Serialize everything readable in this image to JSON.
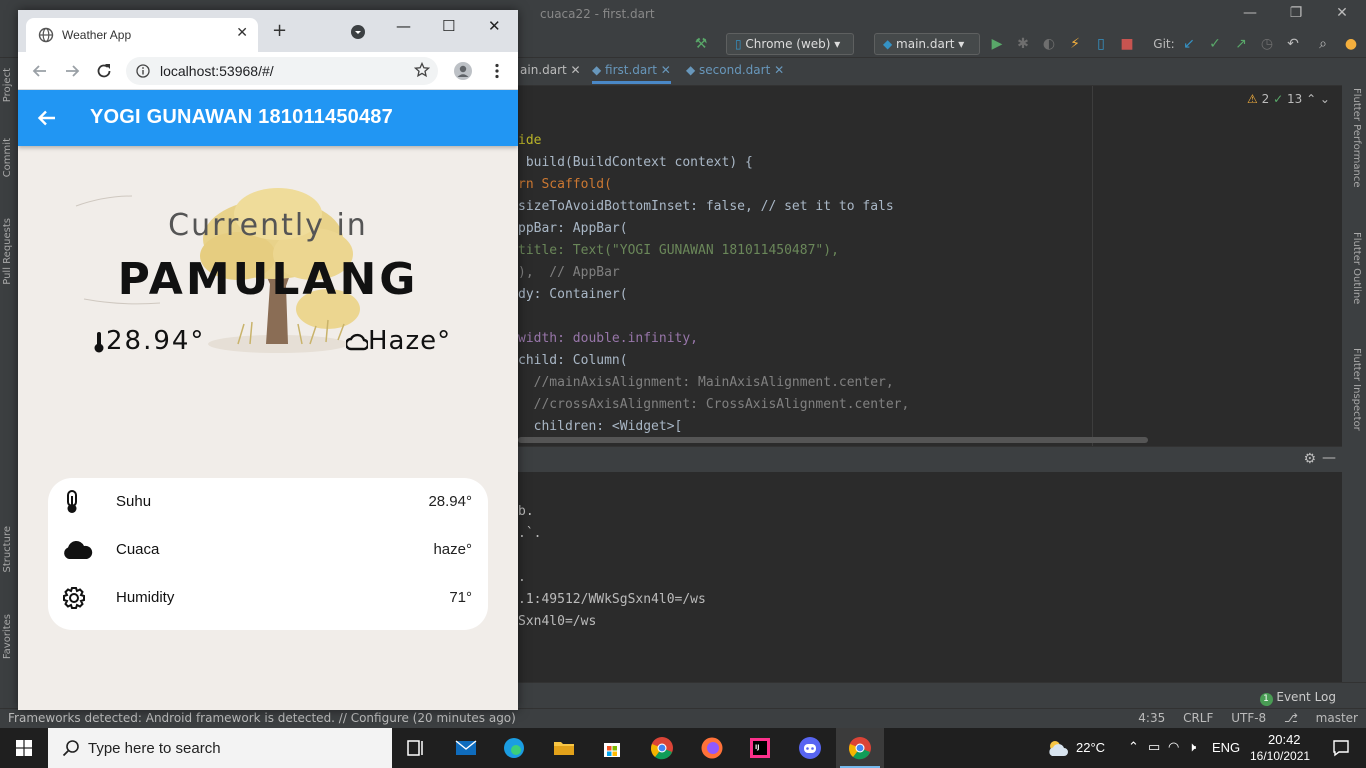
{
  "ide": {
    "window_title": "cuaca22 - first.dart",
    "device_selector": "Chrome (web)",
    "run_config": "main.dart",
    "git_label": "Git:",
    "tabs": [
      {
        "label": "ain.dart"
      },
      {
        "label": "first.dart"
      },
      {
        "label": "second.dart"
      }
    ],
    "inspections": {
      "warnings": "2",
      "typos": "13"
    },
    "left_tool_windows": [
      "Project",
      "Commit",
      "Pull Requests",
      "Structure",
      "Favorites"
    ],
    "right_tool_windows": [
      "Flutter Performance",
      "Flutter Outline",
      "Flutter Inspector"
    ],
    "code_lines": [
      {
        "text": "ide",
        "color": "#bbb529"
      },
      {
        "text": " build(BuildContext context) {",
        "color": "#a9b7c6"
      },
      {
        "text": "rn Scaffold(",
        "color": "#cc7832"
      },
      {
        "text": "sizeToAvoidBottomInset: false, // set it to fals",
        "color": "#a9b7c6"
      },
      {
        "text": "ppBar: AppBar(",
        "color": "#a9b7c6"
      },
      {
        "text": "title: Text(\"YOGI GUNAWAN 181011450487\"),",
        "color": "#6a8759"
      },
      {
        "text": "),  // AppBar",
        "color": "#808080"
      },
      {
        "text": "dy: Container(",
        "color": "#a9b7c6"
      },
      {
        "text": "",
        "color": "#a9b7c6"
      },
      {
        "text": "width: double.infinity,",
        "color": "#9876aa"
      },
      {
        "text": "child: Column(",
        "color": "#a9b7c6"
      },
      {
        "text": "  //mainAxisAlignment: MainAxisAlignment.center,",
        "color": "#808080"
      },
      {
        "text": "  //crossAxisAlignment: CrossAxisAlignment.center,",
        "color": "#808080"
      },
      {
        "text": "  children: <Widget>[",
        "color": "#a9b7c6"
      }
    ],
    "console_lines": [
      "b.",
      ".`.",
      "",
      ".",
      ".1:49512/WWkSgSxn4l0=/ws",
      "Sxn4l0=/ws"
    ],
    "event_log": "Event Log",
    "event_log_count": "1",
    "status_left": "Frameworks detected: Android framework is detected. // Configure (20 minutes ago)",
    "status_right": {
      "position": "4:35",
      "line_sep": "CRLF",
      "encoding": "UTF-8",
      "branch": "master"
    }
  },
  "browser": {
    "tab_title": "Weather App",
    "url": "localhost:53968/#/"
  },
  "app": {
    "appbar_title": "YOGI GUNAWAN 181011450487",
    "currently_in": "Currently in",
    "city": "PAMULANG",
    "temperature": "28.94°",
    "condition": "Haze°",
    "details": [
      {
        "icon": "thermometer-icon",
        "label": "Suhu",
        "value": "28.94°"
      },
      {
        "icon": "cloud-icon",
        "label": "Cuaca",
        "value": "haze°"
      },
      {
        "icon": "gear-icon",
        "label": "Humidity",
        "value": "71°"
      }
    ]
  },
  "taskbar": {
    "search_placeholder": "Type here to search",
    "weather": "22°C",
    "language": "ENG",
    "time": "20:42",
    "date": "16/10/2021"
  },
  "colors": {
    "appbar": "#2196f3",
    "app_background": "#f1ede9",
    "ide_background": "#2b2b2b"
  }
}
